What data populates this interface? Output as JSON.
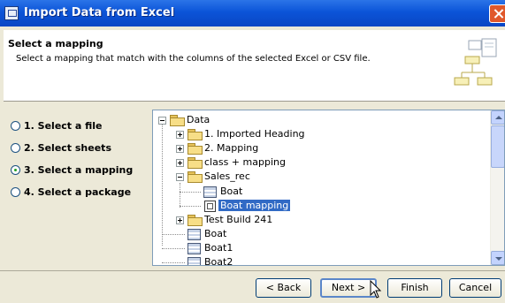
{
  "window": {
    "title": "Import Data from Excel",
    "close_icon": "close-icon"
  },
  "header": {
    "title": "Select a mapping",
    "description": "Select a mapping that match with the columns of the selected Excel or CSV file.",
    "icon": "wizard-diagram-icon"
  },
  "steps": [
    {
      "label": "1. Select a file",
      "checked": false
    },
    {
      "label": "2. Select sheets",
      "checked": false
    },
    {
      "label": "3. Select a mapping",
      "checked": true
    },
    {
      "label": "4. Select a package",
      "checked": false
    }
  ],
  "tree": {
    "root": "Data",
    "nodes": [
      {
        "label": "1. Imported Heading",
        "icon": "folder-icon"
      },
      {
        "label": "2. Mapping",
        "icon": "folder-icon"
      },
      {
        "label": "class + mapping",
        "icon": "folder-icon"
      },
      {
        "label": "Sales_rec",
        "icon": "folder-icon"
      },
      {
        "label": "Boat",
        "icon": "sheet-icon"
      },
      {
        "label": "Boat mapping",
        "icon": "mapping-icon",
        "selected": true
      },
      {
        "label": "Test Build 241",
        "icon": "folder-icon"
      },
      {
        "label": "Boat",
        "icon": "sheet-icon"
      },
      {
        "label": "Boat1",
        "icon": "sheet-icon"
      },
      {
        "label": "Boat2",
        "icon": "sheet-icon"
      }
    ]
  },
  "buttons": {
    "back": "< Back",
    "next": "Next >",
    "finish": "Finish",
    "cancel": "Cancel"
  },
  "colors": {
    "titlebar": "#0b54d8",
    "selection": "#316ac5",
    "dialog": "#ece9d8"
  }
}
